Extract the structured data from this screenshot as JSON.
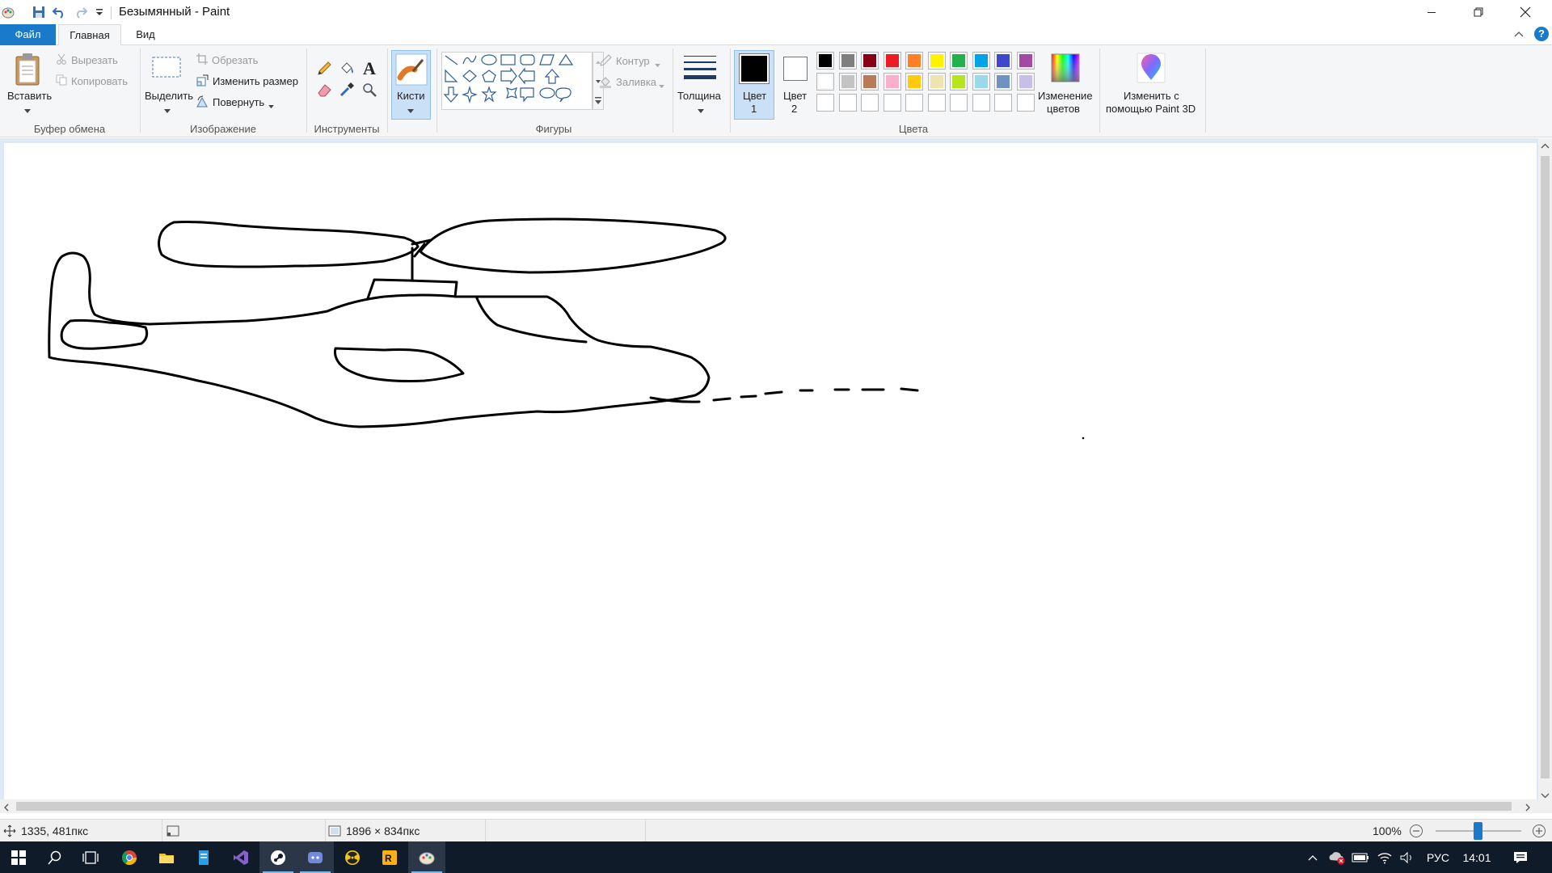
{
  "window": {
    "title": "Безымянный - Paint"
  },
  "tabs": {
    "file": "Файл",
    "home": "Главная",
    "view": "Вид"
  },
  "clipboard": {
    "paste": "Вставить",
    "cut": "Вырезать",
    "copy": "Копировать",
    "group": "Буфер обмена"
  },
  "image": {
    "select": "Выделить",
    "crop": "Обрезать",
    "resize": "Изменить размер",
    "rotate": "Повернуть",
    "group": "Изображение"
  },
  "tools": {
    "group": "Инструменты"
  },
  "brushes": {
    "label": "Кисти"
  },
  "shapes": {
    "outline": "Контур",
    "fill": "Заливка",
    "group": "Фигуры"
  },
  "size": {
    "label": "Толщина"
  },
  "colors": {
    "color1": "Цвет",
    "color1_num": "1",
    "color2": "Цвет",
    "color2_num": "2",
    "edit_line1": "Изменение",
    "edit_line2": "цветов",
    "group": "Цвета",
    "color1_value": "#000000",
    "color2_value": "#ffffff",
    "palette_row1": [
      "#000000",
      "#7f7f7f",
      "#880015",
      "#ed1c24",
      "#ff7f27",
      "#fff200",
      "#22b14c",
      "#00a2e8",
      "#3f48cc",
      "#a349a4"
    ],
    "palette_row2": [
      "#ffffff",
      "#c3c3c3",
      "#b97a57",
      "#ffaec9",
      "#ffc90e",
      "#efe4b0",
      "#b5e61d",
      "#99d9ea",
      "#7092be",
      "#c8bfe7"
    ]
  },
  "paint3d": {
    "line1": "Изменить с",
    "line2": "помощью Paint 3D"
  },
  "status": {
    "cursor": "1335, 481пкс",
    "canvas_size": "1896 × 834пкс",
    "zoom": "100%"
  },
  "taskbar": {
    "lang": "РУС",
    "time": "14:01"
  }
}
